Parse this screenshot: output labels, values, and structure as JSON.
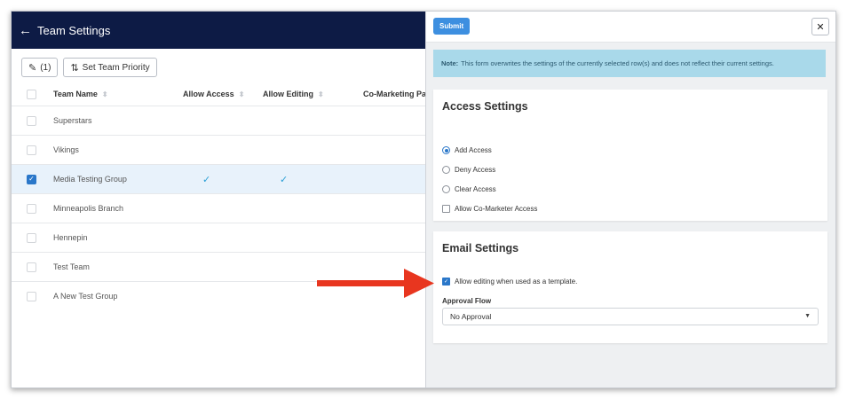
{
  "header": {
    "back_icon": "arrow-left-icon",
    "title": "Team Settings"
  },
  "toolbar": {
    "edit_count": "(1)",
    "set_priority_label": "Set Team Priority"
  },
  "grid": {
    "columns": [
      "Team Name",
      "Allow Access",
      "Allow Editing",
      "Co-Marketing Partn"
    ],
    "rows": [
      {
        "name": "Superstars",
        "access": "",
        "editing": ""
      },
      {
        "name": "Vikings",
        "access": "",
        "editing": ""
      },
      {
        "name": "Media Testing Group",
        "access": "✓",
        "editing": "✓",
        "selected": true
      },
      {
        "name": "Minneapolis Branch",
        "access": "",
        "editing": ""
      },
      {
        "name": "Hennepin",
        "access": "",
        "editing": ""
      },
      {
        "name": "Test Team",
        "access": "",
        "editing": ""
      },
      {
        "name": "A New Test Group",
        "access": "",
        "editing": ""
      }
    ]
  },
  "drawer": {
    "submit_label": "Submit",
    "close_label": "✕",
    "note_bold": "Note:",
    "note_text": "This form overwrites the settings of the currently selected row(s) and does not reflect their current settings.",
    "access": {
      "title": "Access Settings",
      "options": [
        "Add Access",
        "Deny Access",
        "Clear Access"
      ],
      "checkbox_label": "Allow Co-Marketer Access"
    },
    "email": {
      "title": "Email Settings",
      "checkbox_label": "Allow editing when used as a template.",
      "approval_label": "Approval Flow",
      "approval_value": "No Approval"
    }
  },
  "colors": {
    "topbar": "#0d1b45",
    "accent": "#2a77c9",
    "note_bg": "#a9d9ea",
    "arrow": "#e8361f"
  }
}
